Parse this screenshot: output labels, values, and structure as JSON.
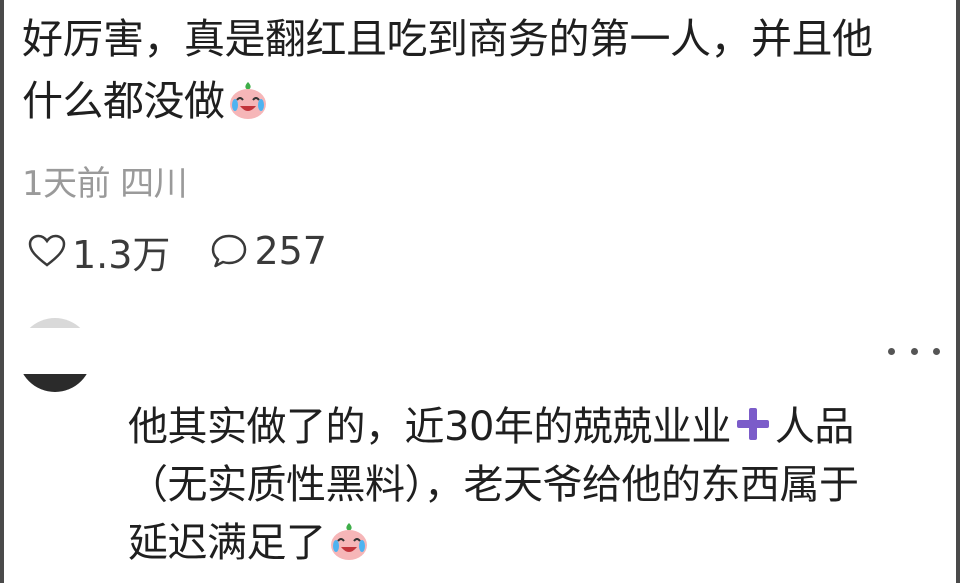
{
  "post": {
    "line1": "好厉害，真是翻红且吃到商务的第一人，并且他",
    "line2": "什么都没做",
    "emoji": "crying-laughing-emoji",
    "time": "1天前",
    "location": "四川"
  },
  "actions": {
    "likes": "1.3万",
    "comments": "257"
  },
  "reply": {
    "line1_a": "他其实做了的，近30年的兢兢业业",
    "line1_b": "人品",
    "line2": "（无实质性黑料），老天爷给他的东西属于",
    "line3": "延迟满足了",
    "plus_color": "#7b5cc9",
    "emoji": "crying-laughing-emoji"
  },
  "colors": {
    "text": "#1f1f1f",
    "meta": "#9a9a9a",
    "accent": "#7b5cc9"
  }
}
